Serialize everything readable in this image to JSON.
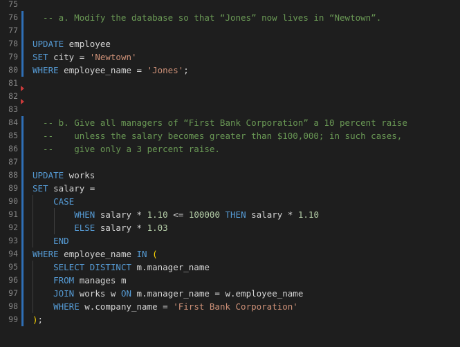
{
  "editor": {
    "language": "sql",
    "colors": {
      "background": "#1e1e1e",
      "keyword": "#569cd6",
      "string": "#ce9178",
      "number": "#b5cea8",
      "comment": "#6a9955",
      "text": "#d4d4d4",
      "line_number": "#858585",
      "modified_bar": "#2f6fb6",
      "deleted_marker": "#c93a3a"
    },
    "lines": [
      {
        "num": "75",
        "tokens": []
      },
      {
        "num": "76",
        "tokens": [
          {
            "t": "  -- a. Modify the database so that “Jones” now lives in “Newtown”.",
            "c": "cm"
          }
        ]
      },
      {
        "num": "77",
        "tokens": []
      },
      {
        "num": "78",
        "tokens": [
          {
            "t": "UPDATE",
            "c": "kw"
          },
          {
            "t": " employee",
            "c": "plain"
          }
        ]
      },
      {
        "num": "79",
        "tokens": [
          {
            "t": "SET",
            "c": "kw"
          },
          {
            "t": " city = ",
            "c": "plain"
          },
          {
            "t": "'Newtown'",
            "c": "str"
          }
        ]
      },
      {
        "num": "80",
        "tokens": [
          {
            "t": "WHERE",
            "c": "kw"
          },
          {
            "t": " employee_name = ",
            "c": "plain"
          },
          {
            "t": "'Jones'",
            "c": "str"
          },
          {
            "t": ";",
            "c": "plain"
          }
        ]
      },
      {
        "num": "81",
        "tokens": []
      },
      {
        "num": "82",
        "tokens": []
      },
      {
        "num": "83",
        "tokens": []
      },
      {
        "num": "84",
        "tokens": [
          {
            "t": "  -- b. Give all managers of “First Bank Corporation” a 10 percent raise",
            "c": "cm"
          }
        ]
      },
      {
        "num": "85",
        "tokens": [
          {
            "t": "  --    unless the salary becomes greater than $100,000; in such cases,",
            "c": "cm"
          }
        ]
      },
      {
        "num": "86",
        "tokens": [
          {
            "t": "  --    give only a 3 percent raise.",
            "c": "cm"
          }
        ]
      },
      {
        "num": "87",
        "tokens": []
      },
      {
        "num": "88",
        "tokens": [
          {
            "t": "UPDATE",
            "c": "kw"
          },
          {
            "t": " works",
            "c": "plain"
          }
        ]
      },
      {
        "num": "89",
        "tokens": [
          {
            "t": "SET",
            "c": "kw"
          },
          {
            "t": " salary =",
            "c": "plain"
          }
        ]
      },
      {
        "num": "90",
        "tokens": [
          {
            "t": "    ",
            "c": "plain"
          },
          {
            "t": "CASE",
            "c": "kw"
          }
        ]
      },
      {
        "num": "91",
        "tokens": [
          {
            "t": "        ",
            "c": "plain"
          },
          {
            "t": "WHEN",
            "c": "kw"
          },
          {
            "t": " salary * ",
            "c": "plain"
          },
          {
            "t": "1.10",
            "c": "num"
          },
          {
            "t": " <= ",
            "c": "plain"
          },
          {
            "t": "100000",
            "c": "num"
          },
          {
            "t": " ",
            "c": "plain"
          },
          {
            "t": "THEN",
            "c": "kw"
          },
          {
            "t": " salary * ",
            "c": "plain"
          },
          {
            "t": "1.10",
            "c": "num"
          }
        ]
      },
      {
        "num": "92",
        "tokens": [
          {
            "t": "        ",
            "c": "plain"
          },
          {
            "t": "ELSE",
            "c": "kw"
          },
          {
            "t": " salary * ",
            "c": "plain"
          },
          {
            "t": "1.03",
            "c": "num"
          }
        ]
      },
      {
        "num": "93",
        "tokens": [
          {
            "t": "    ",
            "c": "plain"
          },
          {
            "t": "END",
            "c": "kw"
          }
        ]
      },
      {
        "num": "94",
        "tokens": [
          {
            "t": "WHERE",
            "c": "kw"
          },
          {
            "t": " employee_name ",
            "c": "plain"
          },
          {
            "t": "IN",
            "c": "kw"
          },
          {
            "t": " ",
            "c": "plain"
          },
          {
            "t": "(",
            "c": "paren2"
          }
        ]
      },
      {
        "num": "95",
        "tokens": [
          {
            "t": "    ",
            "c": "plain"
          },
          {
            "t": "SELECT DISTINCT",
            "c": "kw"
          },
          {
            "t": " m.manager_name",
            "c": "plain"
          }
        ]
      },
      {
        "num": "96",
        "tokens": [
          {
            "t": "    ",
            "c": "plain"
          },
          {
            "t": "FROM",
            "c": "kw"
          },
          {
            "t": " manages m",
            "c": "plain"
          }
        ]
      },
      {
        "num": "97",
        "tokens": [
          {
            "t": "    ",
            "c": "plain"
          },
          {
            "t": "JOIN",
            "c": "kw"
          },
          {
            "t": " works w ",
            "c": "plain"
          },
          {
            "t": "ON",
            "c": "kw"
          },
          {
            "t": " m.manager_name = w.employee_name",
            "c": "plain"
          }
        ]
      },
      {
        "num": "98",
        "tokens": [
          {
            "t": "    ",
            "c": "plain"
          },
          {
            "t": "WHERE",
            "c": "kw"
          },
          {
            "t": " w.company_name = ",
            "c": "plain"
          },
          {
            "t": "'First Bank Corporation'",
            "c": "str"
          }
        ]
      },
      {
        "num": "99",
        "tokens": [
          {
            "t": ")",
            "c": "paren2"
          },
          {
            "t": ";",
            "c": "plain"
          }
        ]
      }
    ]
  }
}
